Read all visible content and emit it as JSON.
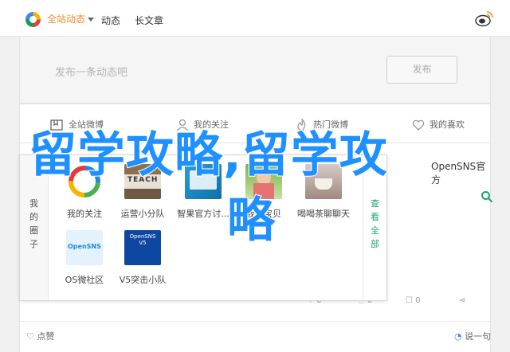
{
  "topbar": {
    "scope_label": "全站动态",
    "tabs": [
      {
        "label": "动态",
        "active": true
      },
      {
        "label": "长文章",
        "active": false
      }
    ]
  },
  "compose": {
    "placeholder": "发布一条动态吧",
    "publish_label": "发布"
  },
  "filters": [
    {
      "label": "全站微博",
      "icon": "bookmark-icon"
    },
    {
      "label": "我的关注",
      "icon": "user-icon"
    },
    {
      "label": "热门微博",
      "icon": "flame-icon"
    },
    {
      "label": "我的喜欢",
      "icon": "heart-icon"
    }
  ],
  "feed": {
    "source": "OpenSNS官方",
    "actions": {
      "repost": "0",
      "comment": "0",
      "share": "0"
    },
    "like_label": "点赞",
    "comment_label": "说一句"
  },
  "panel": {
    "side_label": "我的圈子",
    "view_all_label": "查看全部",
    "circles": [
      {
        "name": "我的关注",
        "icon": "opensns-circle-icon"
      },
      {
        "name": "运营小分队",
        "thumb_text": "TEACH"
      },
      {
        "name": "智果官方讨...",
        "thumb_text": ""
      },
      {
        "name": "我的宝贝",
        "thumb_text": ""
      },
      {
        "name": "喝喝茶聊聊天",
        "thumb_text": ""
      },
      {
        "name": "OS微社区",
        "thumb_text": "OpenSNS"
      },
      {
        "name": "V5突击小队",
        "thumb_text": "OpenSNS V5"
      }
    ]
  },
  "watermark": {
    "line1": "留学攻略,留学攻",
    "line2": "略"
  },
  "colors": {
    "accent": "#f28c2b",
    "green": "#1aa37a",
    "watermark": "#1e90ff"
  }
}
